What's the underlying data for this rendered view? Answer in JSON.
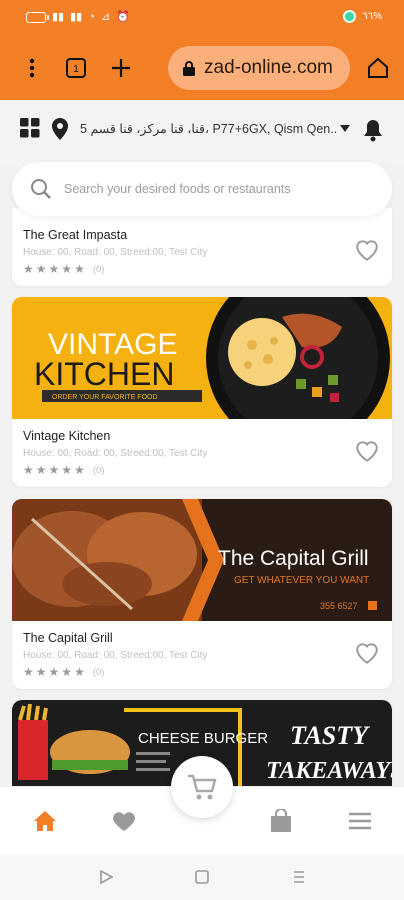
{
  "status_bar": {
    "battery_text": "٦٦%"
  },
  "browser": {
    "url": "zad-online.com"
  },
  "header": {
    "address": "5 قنا، قنا مركز، قنا قسم، P77+6GX, Qism Qen..."
  },
  "search": {
    "placeholder": "Search your desired foods or restaurants"
  },
  "restaurants": [
    {
      "name": "The Great Impasta",
      "address": "House: 00, Road: 00, Streed:00, Test City",
      "rating_count": "(0)",
      "rating": 0
    },
    {
      "name": "Vintage Kitchen",
      "address": "House: 00, Road: 00, Streed:00, Test City",
      "rating_count": "(0)",
      "rating": 0,
      "banner": {
        "line1": "VINTAGE",
        "line2": "KITCHEN",
        "tagline": "ORDER YOUR FAVORITE FOOD"
      }
    },
    {
      "name": "The Capital Grill",
      "address": "House: 00, Road: 00, Streed:00, Test City",
      "rating_count": "(0)",
      "rating": 0,
      "banner": {
        "title": "The Capital Grill",
        "tagline": "GET WHATEVER YOU WANT",
        "phone": "355 6527"
      }
    },
    {
      "banner": {
        "left_text": "CHEESE BURGER",
        "right_line1": "TASTY",
        "right_line2": "TAKEAWAYS"
      }
    }
  ],
  "bottom_nav": {
    "items": [
      "home-icon",
      "heart-icon",
      "cart-icon",
      "bag-icon",
      "menu-icon"
    ],
    "active": "home-icon"
  },
  "colors": {
    "accent": "#f37f26",
    "banner_yellow": "#f5b10f",
    "grill_dark": "#2a1c14"
  }
}
